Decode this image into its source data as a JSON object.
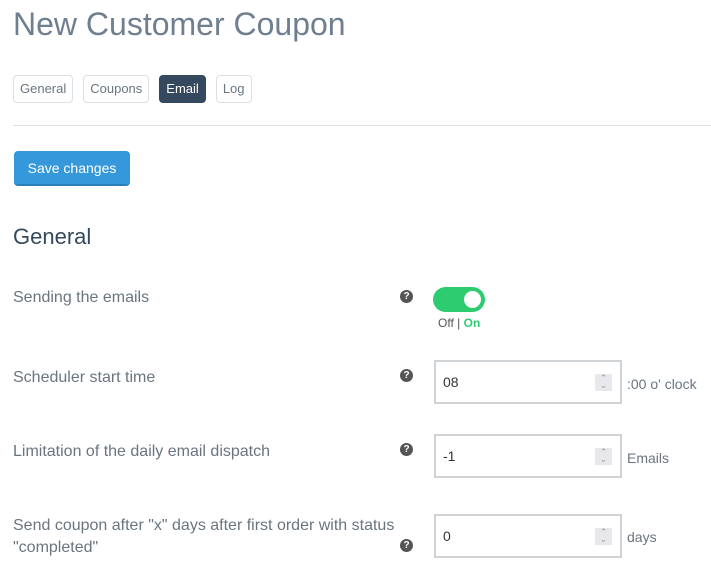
{
  "page": {
    "title": "New Customer Coupon"
  },
  "tabs": [
    {
      "label": "General",
      "active": false
    },
    {
      "label": "Coupons",
      "active": false
    },
    {
      "label": "Email",
      "active": true
    },
    {
      "label": "Log",
      "active": false
    }
  ],
  "toolbar": {
    "save_label": "Save changes"
  },
  "section": {
    "title": "General"
  },
  "fields": {
    "sending": {
      "label": "Sending the emails",
      "enabled": true,
      "off_label": "Off",
      "separator": "|",
      "on_label": "On",
      "help_icon": "question-circle-icon"
    },
    "scheduler": {
      "label": "Scheduler start time",
      "value": "08",
      "unit": ":00 o' clock",
      "help_icon": "question-circle-icon"
    },
    "limit": {
      "label": "Limitation of the daily email dispatch",
      "value": "-1",
      "unit": "Emails",
      "help_icon": "question-circle-icon"
    },
    "delay": {
      "label": "Send coupon after \"x\" days after first order with status \"completed\"",
      "value": "0",
      "unit": "days",
      "help_icon": "question-circle-icon"
    }
  },
  "colors": {
    "accent": "#3498db",
    "active_tab": "#34495e",
    "toggle_on": "#2ecc71"
  }
}
